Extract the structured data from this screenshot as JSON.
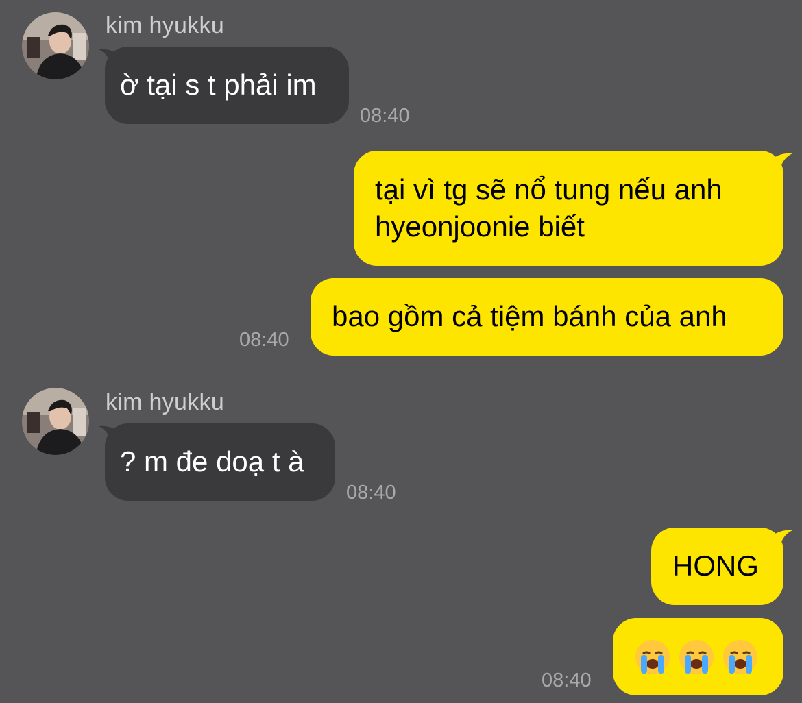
{
  "chat": {
    "colors": {
      "background": "#555456",
      "incoming_bubble": "#3a3a3c",
      "outgoing_bubble": "#fde500",
      "timestamp": "#aaa8ab"
    },
    "messages": [
      {
        "id": 1,
        "direction": "incoming",
        "sender": "kim hyukku",
        "text": "ờ tại s t phải im",
        "time": "08:40"
      },
      {
        "id": 2,
        "direction": "outgoing",
        "lines": [
          "tại vì tg sẽ nổ tung nếu anh",
          "hyeonjoonie biết"
        ]
      },
      {
        "id": 3,
        "direction": "outgoing",
        "text": "bao gồm cả tiệm bánh của anh",
        "time": "08:40"
      },
      {
        "id": 4,
        "direction": "incoming",
        "sender": "kim hyukku",
        "text": "? m đe doạ t à",
        "time": "08:40"
      },
      {
        "id": 5,
        "direction": "outgoing",
        "text": "HONG"
      },
      {
        "id": 6,
        "direction": "outgoing",
        "emoji": [
          "loudly-crying-face",
          "loudly-crying-face",
          "loudly-crying-face"
        ],
        "time": "08:40"
      }
    ]
  }
}
